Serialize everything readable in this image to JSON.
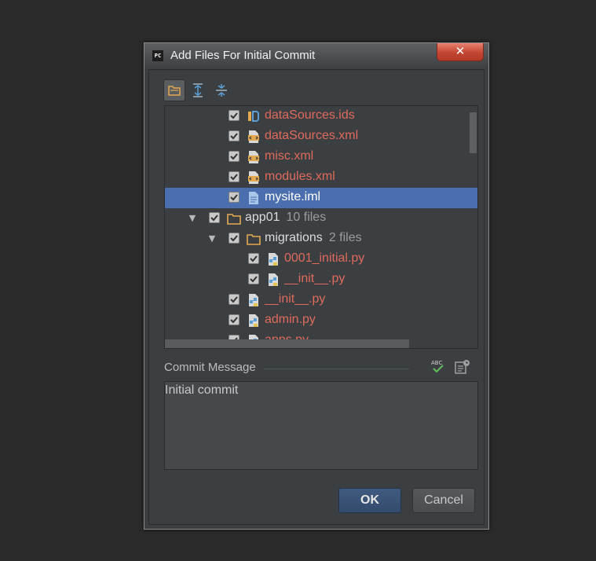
{
  "dialog": {
    "title": "Add Files For Initial Commit",
    "app_badge": "PC",
    "close_glyph": "✕"
  },
  "toolbar": {
    "buttons": [
      "group-by-directory-icon",
      "expand-all-icon",
      "collapse-all-icon"
    ]
  },
  "tree": {
    "rows": [
      {
        "name": "dataSources.ids",
        "type": "ids-file",
        "checked": true,
        "color": "red"
      },
      {
        "name": "dataSources.xml",
        "type": "xml-file",
        "checked": true,
        "color": "red"
      },
      {
        "name": "misc.xml",
        "type": "xml-file",
        "checked": true,
        "color": "red"
      },
      {
        "name": "modules.xml",
        "type": "xml-file",
        "checked": true,
        "color": "red"
      },
      {
        "name": "mysite.iml",
        "type": "iml-file",
        "checked": true,
        "selected": true
      },
      {
        "name": "app01",
        "count": "10 files",
        "type": "folder",
        "checked": true,
        "expanded": true
      },
      {
        "name": "migrations",
        "count": "2 files",
        "type": "folder",
        "checked": true,
        "expanded": true
      },
      {
        "name": "0001_initial.py",
        "type": "python-file",
        "checked": true,
        "color": "red"
      },
      {
        "name": "__init__.py",
        "type": "python-file",
        "checked": true,
        "color": "red"
      },
      {
        "name": "__init__.py",
        "type": "python-file",
        "checked": true,
        "color": "red"
      },
      {
        "name": "admin.py",
        "type": "python-file",
        "checked": true,
        "color": "red"
      },
      {
        "name": "apps.py",
        "type": "python-file",
        "checked": true,
        "color": "red"
      }
    ]
  },
  "commit": {
    "label": "Commit Message",
    "message": "Initial commit"
  },
  "buttons": {
    "ok": "OK",
    "cancel": "Cancel"
  },
  "colors": {
    "background": "#2b2b2b",
    "dialog": "#3c3f41",
    "selection": "#4b6eaf",
    "unversioned_text": "#e06a5c",
    "close_button": "#c34632"
  }
}
